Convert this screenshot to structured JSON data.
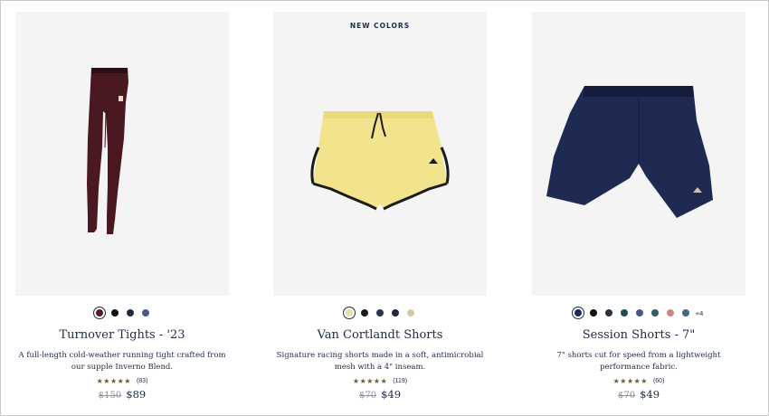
{
  "products": [
    {
      "badge": "",
      "name": "Turnover Tights - '23",
      "description": "A full-length cold-weather running tight crafted from our supple Inverno Blend.",
      "stars": "★★★★★",
      "review_count": "(83)",
      "old_price": "$150",
      "price": "$89",
      "swatches": [
        "#5a1c24",
        "#111111",
        "#1e2a44",
        "#4a5a86"
      ],
      "selected_swatch": 0,
      "colors": {
        "main": "#4a1820",
        "dark": "#2e0e14"
      }
    },
    {
      "badge": "NEW COLORS",
      "name": "Van Cortlandt Shorts",
      "description": "Signature racing shorts made in a soft, antimicrobial mesh with a 4\" inseam.",
      "stars": "★★★★★",
      "review_count": "(119)",
      "old_price": "$70",
      "price": "$49",
      "swatches": [
        "#e8e0a0",
        "#1a1a1a",
        "#2a3552",
        "#1e2a44",
        "#d7c9a8"
      ],
      "selected_swatch": 0,
      "colors": {
        "main": "#f2e48c",
        "trim": "#1b1b1b"
      }
    },
    {
      "badge": "",
      "name": "Session Shorts - 7\"",
      "description": "7\" shorts cut for speed from a lightweight performance fabric.",
      "stars": "★★★★★",
      "review_count": "(60)",
      "old_price": "$70",
      "price": "$49",
      "swatches": [
        "#1e2a55",
        "#111111",
        "#2b2f3f",
        "#1f4d55",
        "#4a5a86",
        "#2f5f6a",
        "#c98a80",
        "#3e6a8a"
      ],
      "selected_swatch": 0,
      "more_colors": "+4",
      "colors": {
        "main": "#1f2a52",
        "dark": "#151d3d"
      }
    }
  ]
}
